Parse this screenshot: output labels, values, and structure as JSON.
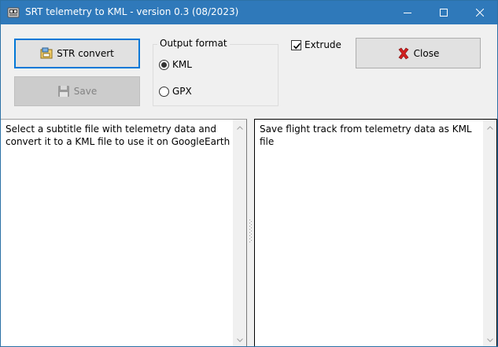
{
  "window": {
    "title": "SRT telemetry to KML - version 0.3 (08/2023)",
    "icon": "app-icon",
    "controls": [
      "minimize-icon",
      "maximize-icon",
      "close-icon"
    ]
  },
  "toolbar": {
    "convert_label": "STR convert",
    "save_label": "Save",
    "close_label": "Close",
    "output_format_label": "Output format",
    "format_options": [
      "KML",
      "GPX"
    ],
    "selected_format": "KML",
    "extrude_label": "Extrude",
    "extrude_checked": true
  },
  "panes": {
    "left_text": "Select a subtitle file with telemetry data and convert it to a KML file to use it on GoogleEarth",
    "right_text": "Save flight track from telemetry data as KML file"
  },
  "colors": {
    "titlebar": "#2f79ba",
    "focus_border": "#0078d7",
    "close_x": "#d11f1f"
  }
}
